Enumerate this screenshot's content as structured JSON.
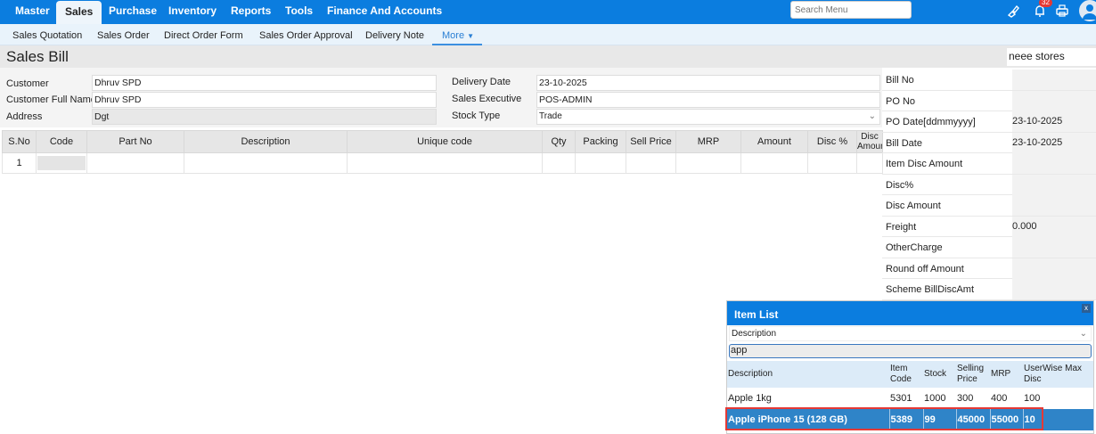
{
  "topnav": {
    "items": [
      "Master",
      "Sales",
      "Purchase",
      "Inventory",
      "Reports",
      "Tools",
      "Finance And Accounts"
    ],
    "active": "Sales",
    "search_placeholder": "Search Menu",
    "notification_count": "32",
    "colors": {
      "bar": "#0b7ddf",
      "badge": "#e53935"
    }
  },
  "subnav": {
    "items": [
      "Sales Quotation",
      "Sales Order",
      "Direct Order Form",
      "Sales Order Approval",
      "Delivery Note"
    ],
    "more": "More"
  },
  "page": {
    "title": "Sales Bill",
    "store": "neee stores"
  },
  "form": {
    "customer_label": "Customer",
    "customer": "Dhruv SPD",
    "fullname_label": "Customer Full Name",
    "fullname": "Dhruv SPD",
    "address_label": "Address",
    "address": "Dgt",
    "delivery_label": "Delivery Date",
    "delivery": "23-10-2025",
    "exec_label": "Sales Executive",
    "exec": "POS-ADMIN",
    "stock_label": "Stock Type",
    "stock": "Trade"
  },
  "grid": {
    "columns": [
      "S.No",
      "Code",
      "Part No",
      "Description",
      "Unique code",
      "Qty",
      "Packing",
      "Sell Price",
      "MRP",
      "Amount",
      "Disc %",
      "Disc Amount"
    ],
    "rows": [
      [
        "1",
        "",
        "",
        "",
        "",
        "",
        "",
        "",
        "",
        "",
        "",
        ""
      ]
    ]
  },
  "right_panel": [
    {
      "label": "Bill No",
      "value": ""
    },
    {
      "label": "PO No",
      "value": ""
    },
    {
      "label": "PO Date[ddmmyyyy]",
      "value": "23-10-2025"
    },
    {
      "label": "Bill Date",
      "value": "23-10-2025"
    },
    {
      "label": "Item Disc Amount",
      "value": ""
    },
    {
      "label": "Disc%",
      "value": ""
    },
    {
      "label": "Disc Amount",
      "value": ""
    },
    {
      "label": "Freight",
      "value": "0.000"
    },
    {
      "label": "OtherCharge",
      "value": ""
    },
    {
      "label": "Round off Amount",
      "value": ""
    },
    {
      "label": "Scheme BillDiscAmt",
      "value": ""
    }
  ],
  "item_list": {
    "title": "Item List",
    "close": "x",
    "search_by": "Description",
    "query": "app",
    "columns": [
      "Description",
      "Item Code",
      "Stock",
      "Selling Price",
      "MRP",
      "UserWise Max Disc"
    ],
    "rows": [
      [
        "Apple 1kg",
        "5301",
        "1000",
        "300",
        "400",
        "100"
      ],
      [
        "Apple iPhone 15 (128 GB)",
        "5389",
        "99",
        "45000",
        "55000",
        "10"
      ]
    ],
    "selected_index": 1,
    "colors": {
      "selected": "#2f84c8",
      "highlight_border": "#e53935"
    }
  }
}
